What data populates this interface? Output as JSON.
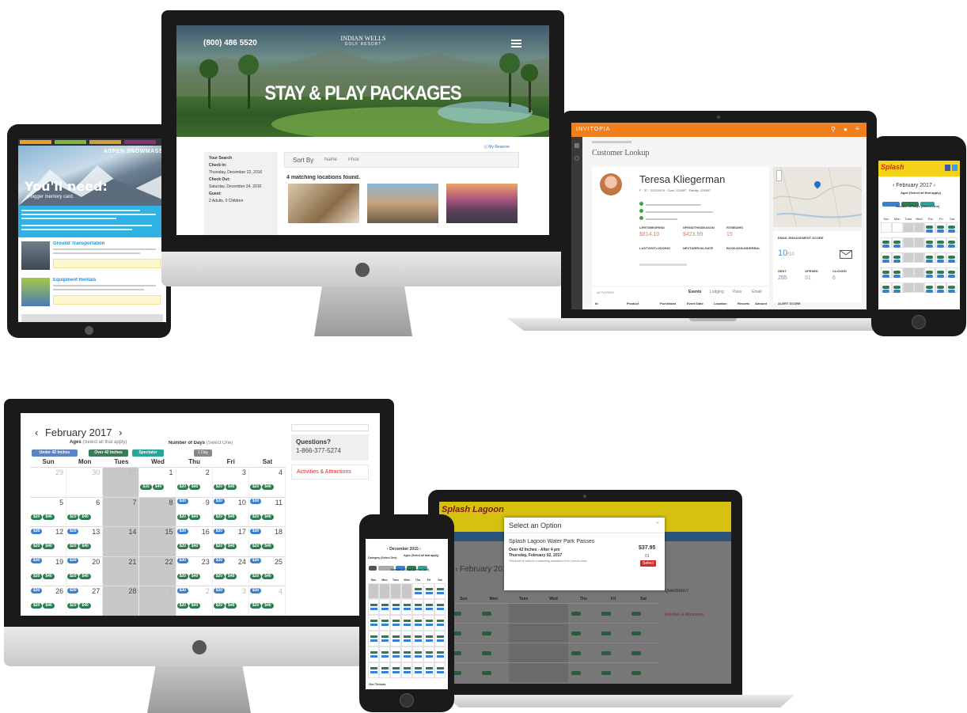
{
  "colors": {
    "invitopia_orange": "#f07f1e",
    "splash_green": "#2e7d4f",
    "splash_blue": "#3b7fd0",
    "red": "#d62b2b"
  },
  "resort": {
    "phone": "(800) 486 5520",
    "logo_line1": "INDIAN WELLS",
    "logo_line2": "GOLF RESORT",
    "hero_title": "STAY & PLAY PACKAGES",
    "reserve_link": "My Reserve",
    "search_heading": "Your Search",
    "check_in_label": "Check In:",
    "check_in_value": "Thursday, December 22, 2016",
    "check_out_label": "Check Out:",
    "check_out_value": "Saturday, December 24, 2016",
    "guest_label": "Guest:",
    "guest_value": "2 Adults, 0 Children",
    "sort_label": "Sort By",
    "sort_name": "Name",
    "sort_price": "Price",
    "results_text": "4 matching locations found."
  },
  "aspen": {
    "logo": "ASPEN SNOWMASS",
    "hero_text": "You'll need:",
    "hero_sub": "A bigger memory card.",
    "item1_title": "Ground Transportation",
    "item2_title": "Equipment Rentals"
  },
  "crm": {
    "brand": "INVITOPIA",
    "page_title": "Customer Lookup",
    "customer_name": "Teresa Kliegerman",
    "meta": "F · 37 · 2/22/1979 · Cust: 123457 · Family: 123457",
    "stat_labels": [
      "LIFETIMESPEND",
      "SPENDTHISSEASON",
      "RTMEDIRS"
    ],
    "stat_values": [
      "$814.10",
      "$423.99",
      "15"
    ],
    "row2_labels": [
      "LASTVISITLODGING",
      "NEXTARRIVALDATE",
      "BOOKASSUNDERBAL"
    ],
    "email_section": "EMAIL ENGAGEMENT SCORE",
    "score_value": "10",
    "score_suffix": "/10",
    "email_labels": [
      "SENT",
      "OPENED",
      "CLICKED"
    ],
    "email_values": [
      "255",
      "31",
      "6"
    ],
    "activities_label": "ACTIVITIES",
    "tabs": [
      "Events",
      "Lodging",
      "Pass",
      "Email"
    ],
    "columns": [
      "Id",
      "Product",
      "Purchased",
      "Event Date",
      "Location",
      "Resorts",
      "Amount"
    ],
    "alert_label": "ALERT SCORE"
  },
  "splash_phone": {
    "logo": "Splash",
    "month": "February 2017",
    "ages_label": "Ages (Select all that apply)",
    "days_label": "Number of Days (Select One)",
    "weekdays": [
      "Sun",
      "Mon",
      "Tues",
      "Wed",
      "Thu",
      "Fri",
      "Sat"
    ]
  },
  "calendar": {
    "month": "February 2017",
    "prev": "‹",
    "next": "›",
    "ages_label": "Ages",
    "ages_hint": "(Select all that apply)",
    "age_buttons": [
      "Under 42 Inches",
      "Over 42 Inches",
      "Spectator"
    ],
    "days_label": "Number of Days",
    "days_hint": "(Select One)",
    "day_button": "1 Day",
    "weekdays": [
      "Sun",
      "Mon",
      "Tues",
      "Wed",
      "Thu",
      "Fri",
      "Sat"
    ],
    "weeks": [
      [
        "29",
        "30",
        "31",
        "1",
        "2",
        "3",
        "4"
      ],
      [
        "5",
        "6",
        "7",
        "8",
        "9",
        "10",
        "11"
      ],
      [
        "12",
        "13",
        "14",
        "15",
        "16",
        "17",
        "18"
      ],
      [
        "19",
        "20",
        "21",
        "22",
        "23",
        "24",
        "25"
      ],
      [
        "26",
        "27",
        "28",
        "1",
        "2",
        "3",
        "4"
      ]
    ],
    "pill_prices": [
      "$20",
      "$40",
      "$30"
    ],
    "questions_label": "Questions?",
    "questions_phone": "1-866-377-5274",
    "sidebar_link": "Activities & Attractions"
  },
  "laptop_modal": {
    "brand": "Splash Lagoon",
    "month": "February 2017",
    "modal_title": "Select an Option",
    "product_title": "Splash Lagoon Water Park Passes",
    "product_sub": "Over 42 Inches - After 4 pm",
    "product_date": "Thursday, February 02, 2017",
    "product_note": "This ticket is valid for a swimming admission from 4 pm to close.",
    "price": "$37.95",
    "qty": "01",
    "select_button": "Select",
    "weekdays": [
      "Sun",
      "Mon",
      "Tues",
      "Wed",
      "Thu",
      "Fri",
      "Sat"
    ],
    "questions": "Questions?",
    "side_link": "Activities & Attractions"
  },
  "small_phone": {
    "month": "December 2015",
    "category_label": "Category (Select One)",
    "ages_label": "Ages (Select all that apply)",
    "days_label": "Number of Days (Select One)",
    "weekdays": [
      "Sun",
      "Mon",
      "Tues",
      "Wed",
      "Thu",
      "Fri",
      "Sat"
    ],
    "footer": "Get Tickets"
  }
}
